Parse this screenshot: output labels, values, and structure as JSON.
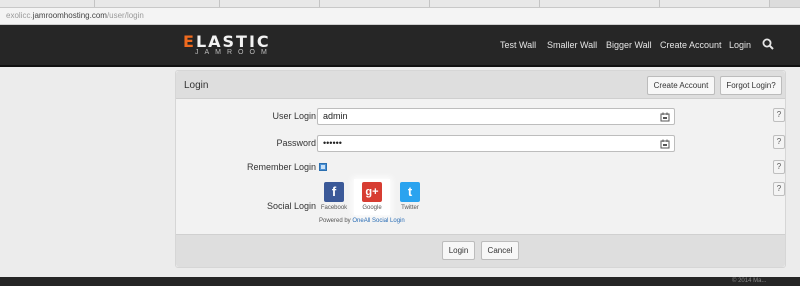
{
  "browser": {
    "url_prefix": "exolicc.",
    "url_host": "jamroomhosting.com",
    "url_path": "/user/login"
  },
  "navbar": {
    "logo_main_first": "E",
    "logo_main_rest": "LASTIC",
    "logo_sub": "JAMROOM",
    "links": [
      "Test Wall",
      "Smaller Wall",
      "Bigger Wall",
      "Create Account",
      "Login"
    ],
    "search_icon": "search-icon"
  },
  "login_panel": {
    "title": "Login",
    "create_account_label": "Create Account",
    "forgot_login_label": "Forgot Login?",
    "user_login_label": "User Login",
    "user_login_value": "admin",
    "password_label": "Password",
    "password_value": "••••••",
    "remember_login_label": "Remember Login",
    "remember_checked": true,
    "social_login_label": "Social Login",
    "social": [
      {
        "name": "Facebook",
        "glyph": "f",
        "color": "#3b5998"
      },
      {
        "name": "Google",
        "glyph": "g+",
        "color": "#d73d32"
      },
      {
        "name": "Twitter",
        "glyph": "t",
        "color": "#2aa3ef"
      }
    ],
    "powered_by": "Powered by ",
    "powered_link": "OneAll Social Login",
    "help_label": "?",
    "login_button": "Login",
    "cancel_button": "Cancel"
  },
  "footer": {
    "meta": "© 2014 Ma..."
  }
}
